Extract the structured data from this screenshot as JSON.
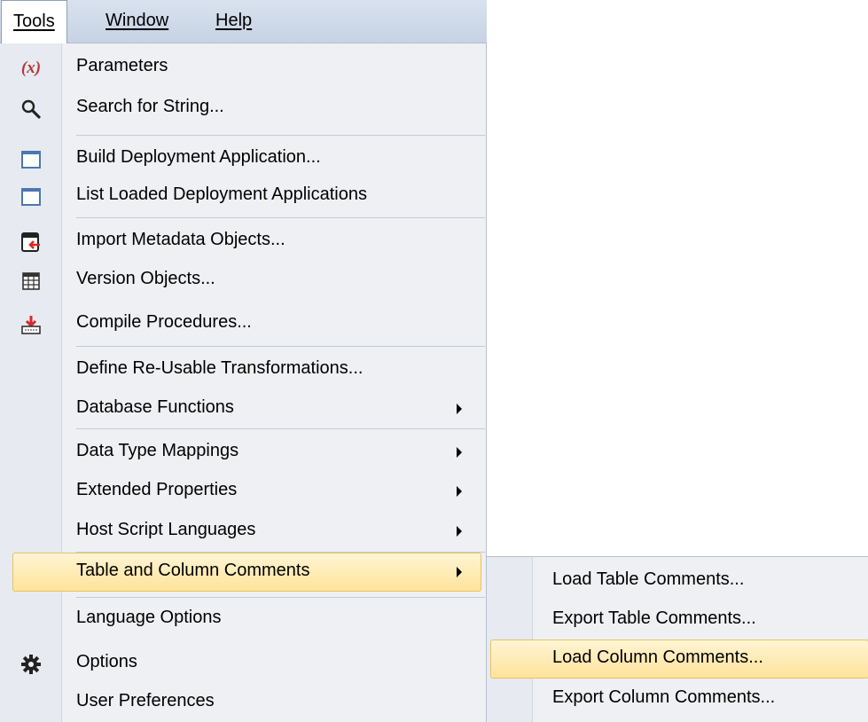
{
  "menubar": {
    "tools": "Tools",
    "window": "Window",
    "help": "Help"
  },
  "menu": {
    "items": [
      {
        "label": "Parameters",
        "icon": "parameters-icon"
      },
      {
        "label": "Search for String...",
        "icon": "search-icon"
      },
      {
        "label": "Build Deployment Application...",
        "icon": "window-icon"
      },
      {
        "label": "List Loaded Deployment Applications",
        "icon": "window-icon"
      },
      {
        "label": "Import Metadata Objects...",
        "icon": "import-icon"
      },
      {
        "label": "Version Objects...",
        "icon": "grid-icon"
      },
      {
        "label": "Compile Procedures...",
        "icon": "compile-icon"
      },
      {
        "label": "Define Re-Usable Transformations...",
        "icon": ""
      },
      {
        "label": "Database Functions",
        "icon": "",
        "submenu": true
      },
      {
        "label": "Data Type Mappings",
        "icon": "",
        "submenu": true
      },
      {
        "label": "Extended Properties",
        "icon": "",
        "submenu": true
      },
      {
        "label": "Host Script Languages",
        "icon": "",
        "submenu": true
      },
      {
        "label": "Table and Column Comments",
        "icon": "",
        "submenu": true,
        "highlighted": true
      },
      {
        "label": "Language Options",
        "icon": ""
      },
      {
        "label": "Options",
        "icon": "gear-icon"
      },
      {
        "label": "User Preferences",
        "icon": ""
      }
    ]
  },
  "submenu": {
    "items": [
      {
        "label": "Load Table Comments..."
      },
      {
        "label": "Export Table Comments..."
      },
      {
        "label": "Load Column Comments...",
        "highlighted": true
      },
      {
        "label": "Export Column Comments..."
      }
    ]
  },
  "colors": {
    "highlight": "#ffe39a",
    "menu_bg": "#eef0f4",
    "menubar_bg": "#c6d3e4"
  }
}
